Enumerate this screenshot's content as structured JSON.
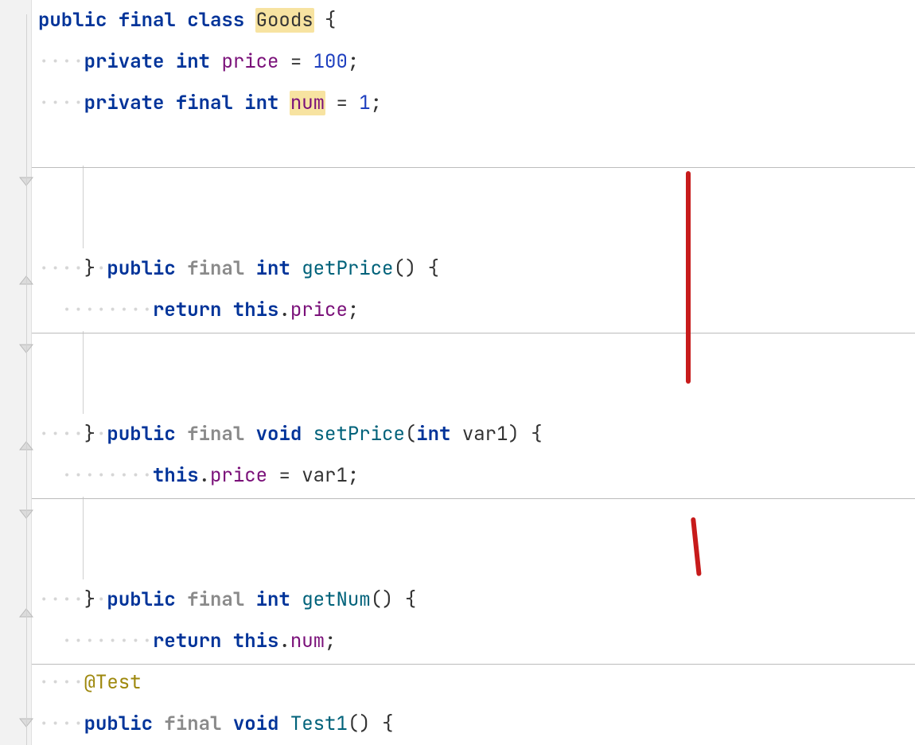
{
  "code": {
    "ws4": "····",
    "ws8": "········",
    "public": "public",
    "private": "private",
    "final": "final",
    "class_kw": "class",
    "int_kw": "int",
    "void_kw": "void",
    "return_kw": "return",
    "this_kw": "this",
    "class_name": "Goods",
    "field_price": "price",
    "field_num": "num",
    "eq": "=",
    "num_100": "100",
    "num_1": "1",
    "semi": ";",
    "colon_paren_empty": "()",
    "paren_open": "(",
    "paren_close": ")",
    "brace_open": "{",
    "brace_close": "}",
    "dot": ".",
    "method_getPrice": "getPrice",
    "method_setPrice": "setPrice",
    "method_getNum": "getNum",
    "method_Test1": "Test1",
    "param_var1": "var1",
    "anno_test": "@Test",
    "ws1": " "
  }
}
